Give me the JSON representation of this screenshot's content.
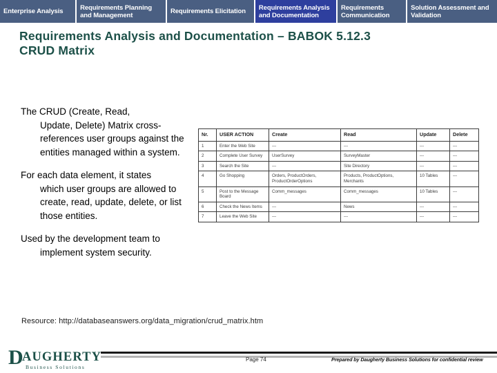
{
  "nav": {
    "tabs": [
      {
        "label": "Enterprise Analysis",
        "active": false
      },
      {
        "label": "Requirements Planning and Management",
        "active": false
      },
      {
        "label": "Requirements Elicitation",
        "active": false
      },
      {
        "label": "Requirements Analysis and Documentation",
        "active": true
      },
      {
        "label": "Requirements Communication",
        "active": false
      },
      {
        "label": "Solution Assessment and Validation",
        "active": false
      }
    ],
    "inactive_color": "#4a5f82",
    "active_color": "#2e3f9e"
  },
  "title": {
    "line1": "Requirements Analysis and Documentation – BABOK 5.12.3",
    "line2": "CRUD Matrix",
    "color": "#1c5048"
  },
  "body": {
    "paragraphs": [
      {
        "lead": "The CRUD (Create, Read,",
        "continuation": "Update, Delete) Matrix cross-references user groups against the entities managed within a system."
      },
      {
        "lead": "For each data element, it states",
        "continuation": "which user groups are allowed to create, read, update, delete, or list those entities."
      },
      {
        "lead": "Used by the development team to",
        "continuation": "implement system security."
      }
    ]
  },
  "crud_table": {
    "headers": [
      "Nr.",
      "USER ACTION",
      "Create",
      "Read",
      "Update",
      "Delete"
    ],
    "rows": [
      {
        "cells": [
          "1",
          "Enter the Web Site",
          "---",
          "---",
          "---",
          "---"
        ],
        "faint": [
          true,
          true,
          false,
          false,
          false,
          false
        ],
        "thick_bottom": false
      },
      {
        "cells": [
          "2",
          "Complete User Survey",
          "UserSurvey",
          "SurveyMaster",
          "---",
          "---"
        ],
        "faint": [
          true,
          true,
          true,
          true,
          true,
          true
        ],
        "thick_bottom": true
      },
      {
        "cells": [
          "3",
          "Search the Site",
          "---",
          "Site Directory",
          "---",
          "---"
        ],
        "faint": [
          false,
          false,
          false,
          false,
          false,
          false
        ],
        "thick_bottom": false
      },
      {
        "cells": [
          "4",
          "Go Shopping",
          "Orders, ProductOrders, ProductOrderOptions",
          "Products, ProductOptions, Merchants",
          "10 Tables",
          "---"
        ],
        "faint": [
          false,
          false,
          false,
          false,
          false,
          false
        ],
        "thick_bottom": false
      },
      {
        "cells": [
          "5",
          "Post to the Message Board",
          "Comm_messages",
          "Comm_messages",
          "10 Tables",
          "---"
        ],
        "faint": [
          false,
          false,
          false,
          false,
          false,
          true
        ],
        "thick_bottom": false
      },
      {
        "cells": [
          "6",
          "Check the News Items",
          "---",
          "News",
          "---",
          "---"
        ],
        "faint": [
          false,
          false,
          false,
          false,
          false,
          false
        ],
        "thick_bottom": false
      },
      {
        "cells": [
          "7",
          "Leave the Web Site",
          "---",
          "---",
          "---",
          "---"
        ],
        "faint": [
          true,
          false,
          true,
          true,
          true,
          true
        ],
        "thick_bottom": false
      }
    ]
  },
  "resource": {
    "text": "Resource: http://databaseanswers.org/data_migration/crud_matrix.htm"
  },
  "footer": {
    "logo_initial": "D",
    "logo_word": "AUGHERTY",
    "logo_tagline": "Business Solutions",
    "logo_color": "#1c5048",
    "page_number": "Page 74",
    "confidential": "Prepared by Daugherty Business Solutions for confidential review"
  }
}
